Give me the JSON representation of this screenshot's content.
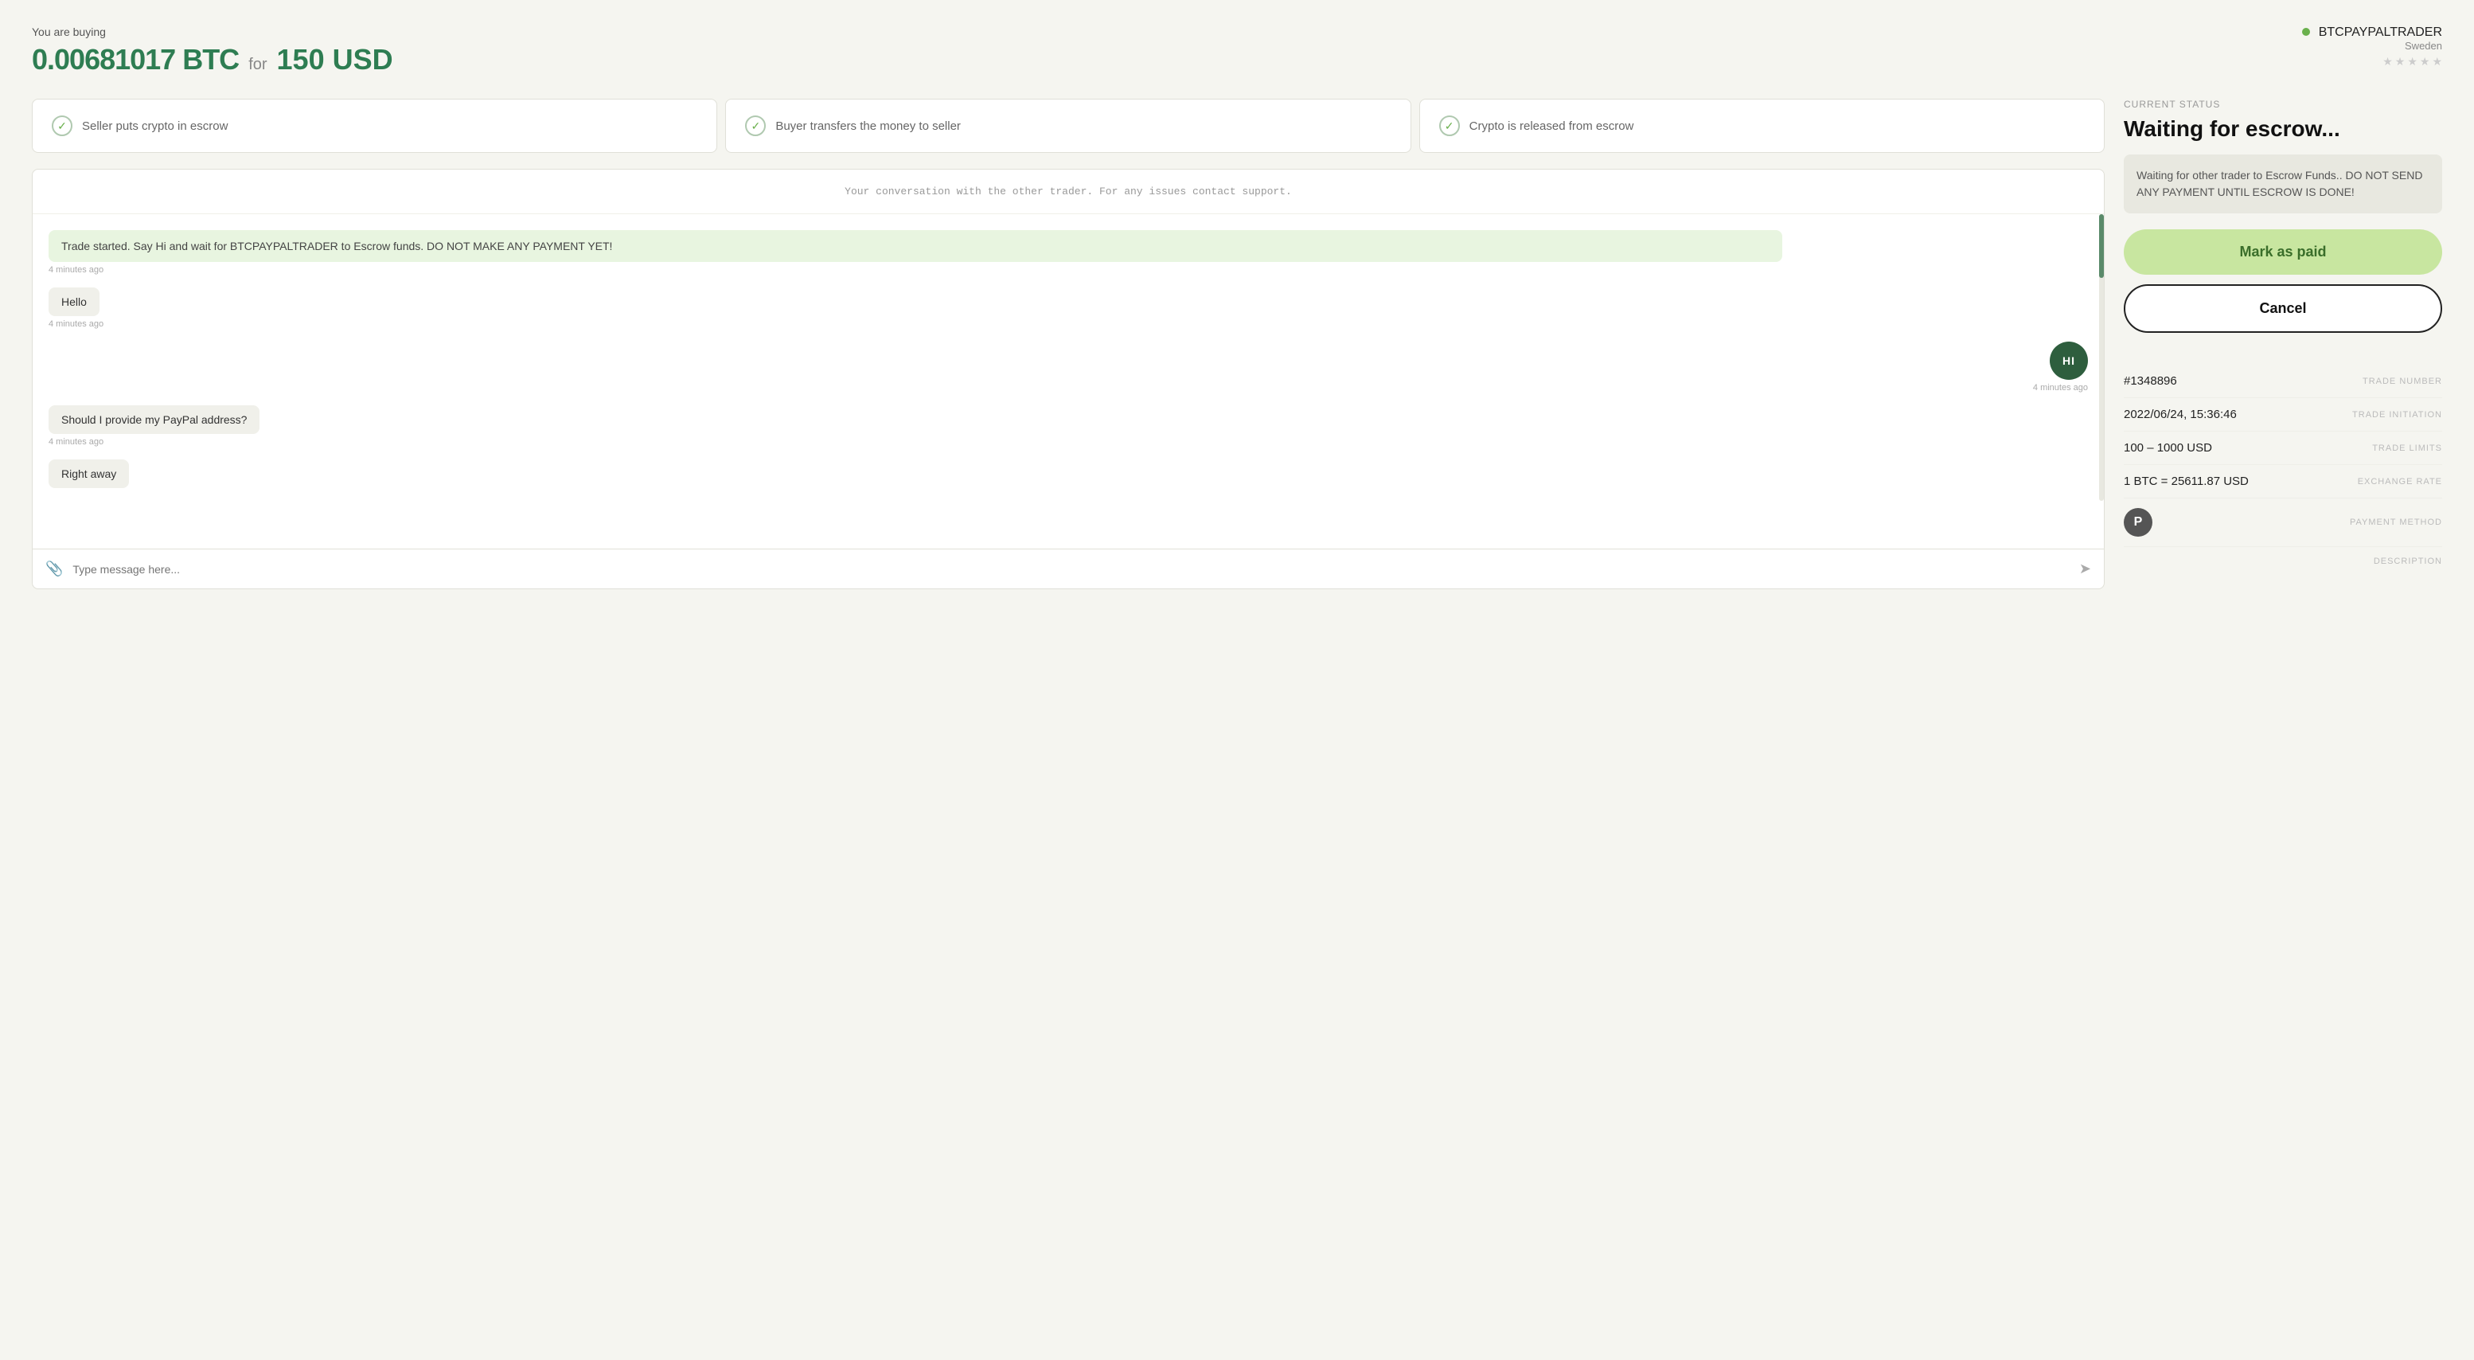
{
  "header": {
    "you_are_buying": "You are buying",
    "btc_amount": "0.00681017 BTC",
    "for_label": "for",
    "usd_amount": "150 USD"
  },
  "seller": {
    "name": "BTCPAYPALTRADER",
    "country": "Sweden",
    "stars": [
      "empty",
      "empty",
      "empty",
      "empty",
      "empty"
    ]
  },
  "steps": [
    {
      "label": "Seller puts crypto in escrow"
    },
    {
      "label": "Buyer transfers the money to seller"
    },
    {
      "label": "Crypto is released from escrow"
    }
  ],
  "chat": {
    "notice": "Your conversation with the other trader. For any issues contact support.",
    "messages": [
      {
        "type": "system",
        "text": "Trade started. Say Hi and wait for BTCPAYPALTRADER to Escrow funds. DO NOT MAKE ANY PAYMENT YET!",
        "time": "4 minutes ago"
      },
      {
        "type": "left",
        "text": "Hello",
        "time": "4 minutes ago"
      },
      {
        "type": "right",
        "text": "HI",
        "time": "4 minutes ago"
      },
      {
        "type": "left",
        "text": "Should I provide my PayPal address?",
        "time": "4 minutes ago"
      },
      {
        "type": "left",
        "text": "Right away",
        "time": ""
      }
    ],
    "input_placeholder": "Type message here..."
  },
  "status": {
    "current_status_label": "CURRENT STATUS",
    "title": "Waiting for escrow...",
    "warning": "Waiting for other trader to Escrow Funds.. DO NOT SEND ANY PAYMENT UNTIL ESCROW IS DONE!",
    "mark_as_paid": "Mark as paid",
    "cancel": "Cancel"
  },
  "trade_details": [
    {
      "value": "#1348896",
      "key": "TRADE NUMBER"
    },
    {
      "value": "2022/06/24, 15:36:46",
      "key": "TRADE INITIATION"
    },
    {
      "value": "100 – 1000 USD",
      "key": "TRADE LIMITS"
    },
    {
      "value": "1 BTC = 25611.87 USD",
      "key": "EXCHANGE RATE"
    }
  ],
  "payment_method": {
    "key": "PAYMENT METHOD",
    "icon_letter": "P"
  },
  "description": {
    "key": "DESCRIPTION"
  }
}
